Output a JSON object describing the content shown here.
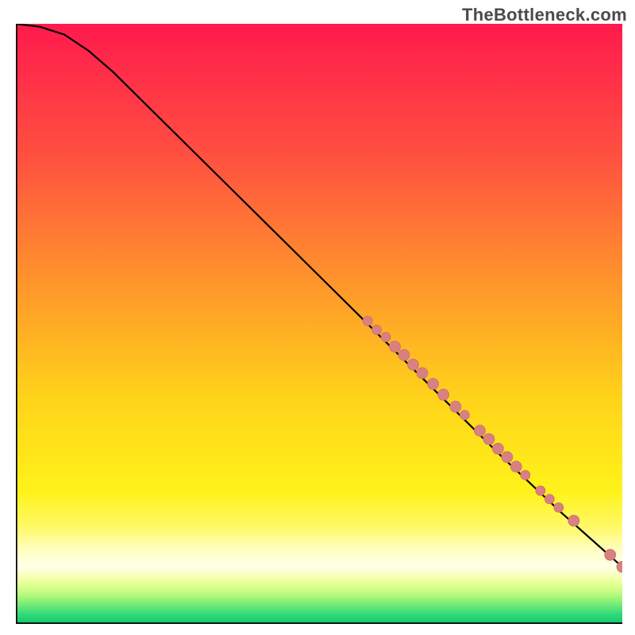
{
  "attribution": "TheBottleneck.com",
  "colors": {
    "curve": "#000000",
    "marker_fill": "#d98181",
    "marker_stroke": "#c77070",
    "gradient_stops": [
      {
        "offset": 0.0,
        "color": "#ff1a4d"
      },
      {
        "offset": 0.22,
        "color": "#ff5040"
      },
      {
        "offset": 0.45,
        "color": "#ff9b2a"
      },
      {
        "offset": 0.62,
        "color": "#ffd21a"
      },
      {
        "offset": 0.78,
        "color": "#fff31a"
      },
      {
        "offset": 0.84,
        "color": "#fff96a"
      },
      {
        "offset": 0.88,
        "color": "#ffffc8"
      },
      {
        "offset": 0.905,
        "color": "#ffffe8"
      },
      {
        "offset": 0.915,
        "color": "#fbffc8"
      },
      {
        "offset": 0.925,
        "color": "#f2ffa8"
      },
      {
        "offset": 0.94,
        "color": "#d8ff8a"
      },
      {
        "offset": 0.955,
        "color": "#a8f878"
      },
      {
        "offset": 0.97,
        "color": "#6ce878"
      },
      {
        "offset": 0.985,
        "color": "#2ed878"
      },
      {
        "offset": 1.0,
        "color": "#14c870"
      }
    ]
  },
  "chart_data": {
    "type": "line",
    "title": "",
    "xlabel": "",
    "ylabel": "",
    "xlim": [
      0,
      100
    ],
    "ylim": [
      0,
      100
    ],
    "grid": false,
    "legend": false,
    "curve": [
      {
        "x": 0,
        "y": 100.0
      },
      {
        "x": 4,
        "y": 99.5
      },
      {
        "x": 8,
        "y": 98.2
      },
      {
        "x": 12,
        "y": 95.5
      },
      {
        "x": 16,
        "y": 92.0
      },
      {
        "x": 25,
        "y": 83.0
      },
      {
        "x": 35,
        "y": 73.0
      },
      {
        "x": 50,
        "y": 58.0
      },
      {
        "x": 65,
        "y": 43.0
      },
      {
        "x": 80,
        "y": 28.0
      },
      {
        "x": 90,
        "y": 18.5
      },
      {
        "x": 100,
        "y": 9.5
      }
    ],
    "markers": [
      {
        "x": 58.0,
        "y": 50.5,
        "r": 6
      },
      {
        "x": 59.5,
        "y": 49.0,
        "r": 6
      },
      {
        "x": 61.0,
        "y": 47.8,
        "r": 6
      },
      {
        "x": 62.5,
        "y": 46.2,
        "r": 7
      },
      {
        "x": 64.0,
        "y": 44.8,
        "r": 7
      },
      {
        "x": 65.5,
        "y": 43.2,
        "r": 7
      },
      {
        "x": 67.0,
        "y": 41.8,
        "r": 7
      },
      {
        "x": 68.8,
        "y": 40.0,
        "r": 7
      },
      {
        "x": 70.5,
        "y": 38.2,
        "r": 7
      },
      {
        "x": 72.5,
        "y": 36.2,
        "r": 7
      },
      {
        "x": 74.0,
        "y": 34.8,
        "r": 6
      },
      {
        "x": 76.5,
        "y": 32.2,
        "r": 7
      },
      {
        "x": 78.0,
        "y": 30.8,
        "r": 7
      },
      {
        "x": 79.5,
        "y": 29.2,
        "r": 7
      },
      {
        "x": 81.0,
        "y": 27.8,
        "r": 7
      },
      {
        "x": 82.5,
        "y": 26.2,
        "r": 7
      },
      {
        "x": 84.0,
        "y": 24.8,
        "r": 6
      },
      {
        "x": 86.5,
        "y": 22.2,
        "r": 6
      },
      {
        "x": 88.0,
        "y": 20.8,
        "r": 6
      },
      {
        "x": 89.5,
        "y": 19.4,
        "r": 6
      },
      {
        "x": 92.0,
        "y": 17.2,
        "r": 7
      },
      {
        "x": 98.0,
        "y": 11.5,
        "r": 7
      },
      {
        "x": 100.0,
        "y": 9.5,
        "r": 7
      }
    ]
  }
}
